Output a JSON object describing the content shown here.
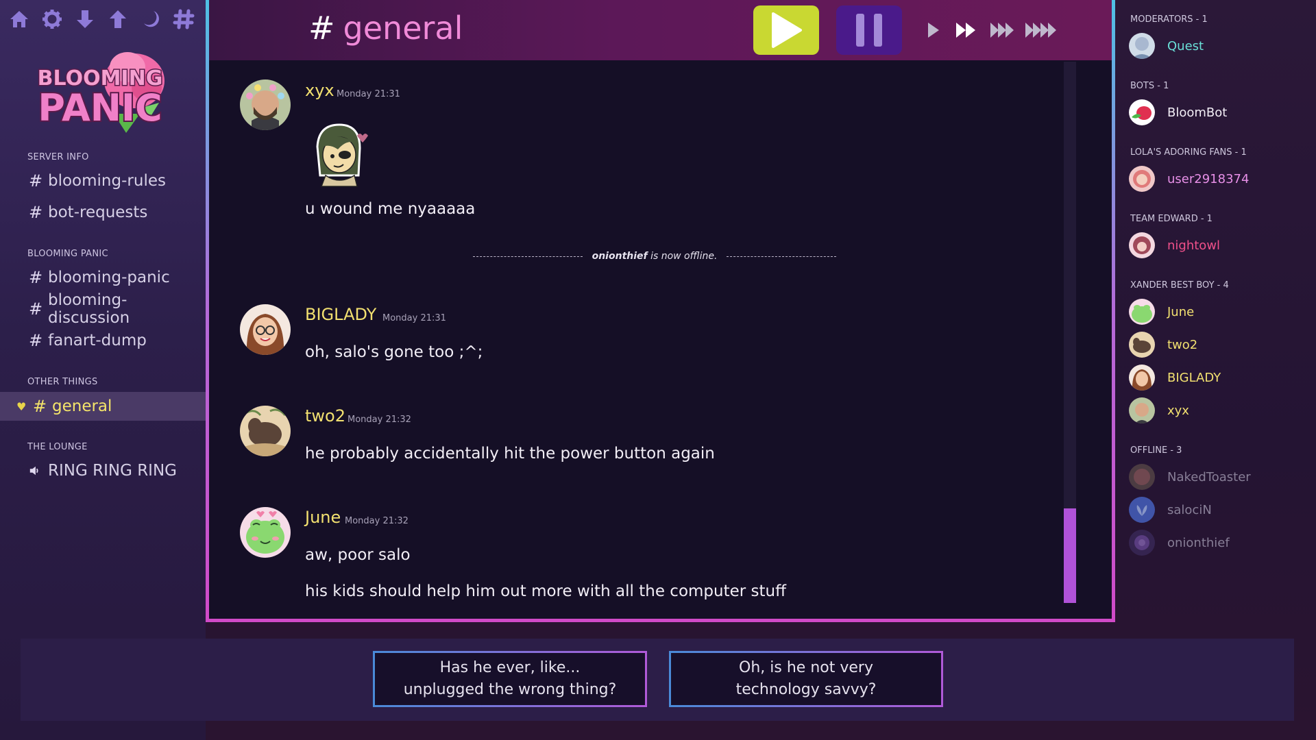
{
  "toolbar": {
    "icons": [
      "home-icon",
      "gear-icon",
      "arrow-down-icon",
      "arrow-up-icon",
      "moon-icon",
      "hash-icon"
    ]
  },
  "logo": {
    "line1": "BLOOMING",
    "line2": "PANIC"
  },
  "sidebar": {
    "categories": [
      {
        "name": "SERVER INFO",
        "channels": [
          "blooming-rules",
          "bot-requests"
        ]
      },
      {
        "name": "BLOOMING PANIC",
        "channels": [
          "blooming-panic",
          "blooming-discussion",
          "fanart-dump"
        ]
      },
      {
        "name": "OTHER THINGS",
        "channels": [
          "general"
        ]
      },
      {
        "name": "THE LOUNGE",
        "channels": [
          "RING RING RING"
        ]
      }
    ],
    "hash": "#",
    "active_channel": "general"
  },
  "header": {
    "hash": "#",
    "channel_title": "general",
    "colors": {
      "play": "#c9d832",
      "pause": "#4a1a8a",
      "title": "#f08ad8"
    }
  },
  "messages": [
    {
      "user": "xyx",
      "time": "Monday 21:31",
      "lines": [
        "u wound me nyaaaaa"
      ],
      "has_sticker": true
    },
    {
      "user": "BIGLADY",
      "time": "Monday 21:31",
      "lines": [
        "oh, salo's gone too ;^;"
      ]
    },
    {
      "user": "two2",
      "time": "Monday 21:32",
      "lines": [
        "he probably accidentally hit the power button again"
      ]
    },
    {
      "user": "June",
      "time": "Monday 21:32",
      "lines": [
        "aw, poor salo",
        "his kids should help him out more with all the computer stuff"
      ]
    }
  ],
  "system_message": {
    "name": "onionthief",
    "text": "is now offline."
  },
  "scroll": {
    "position_fraction": 0.82
  },
  "members": {
    "groups": [
      {
        "title": "MODERATORS - 1",
        "members": [
          {
            "name": "Quest",
            "color": "#6ae0d8"
          }
        ]
      },
      {
        "title": "BOTS - 1",
        "members": [
          {
            "name": "BloomBot",
            "color": "#f2eef6"
          }
        ]
      },
      {
        "title": "LOLA'S ADORING FANS - 1",
        "members": [
          {
            "name": "user2918374",
            "color": "#e890e8"
          }
        ]
      },
      {
        "title": "TEAM EDWARD - 1",
        "members": [
          {
            "name": "nightowl",
            "color": "#f0508a"
          }
        ]
      },
      {
        "title": "XANDER BEST BOY - 4",
        "members": [
          {
            "name": "June",
            "color": "#f2e070"
          },
          {
            "name": "two2",
            "color": "#f2e070"
          },
          {
            "name": "BIGLADY",
            "color": "#f2e070"
          },
          {
            "name": "xyx",
            "color": "#f2e070"
          }
        ]
      },
      {
        "title": "OFFLINE - 3",
        "members": [
          {
            "name": "NakedToaster",
            "color": "#a8a2b8"
          },
          {
            "name": "salociN",
            "color": "#a8a2b8"
          },
          {
            "name": "onionthief",
            "color": "#a8a2b8"
          }
        ]
      }
    ]
  },
  "choices": [
    "Has he ever, like...\nunplugged the wrong thing?",
    "Oh, is he not very\ntechnology savvy?"
  ]
}
